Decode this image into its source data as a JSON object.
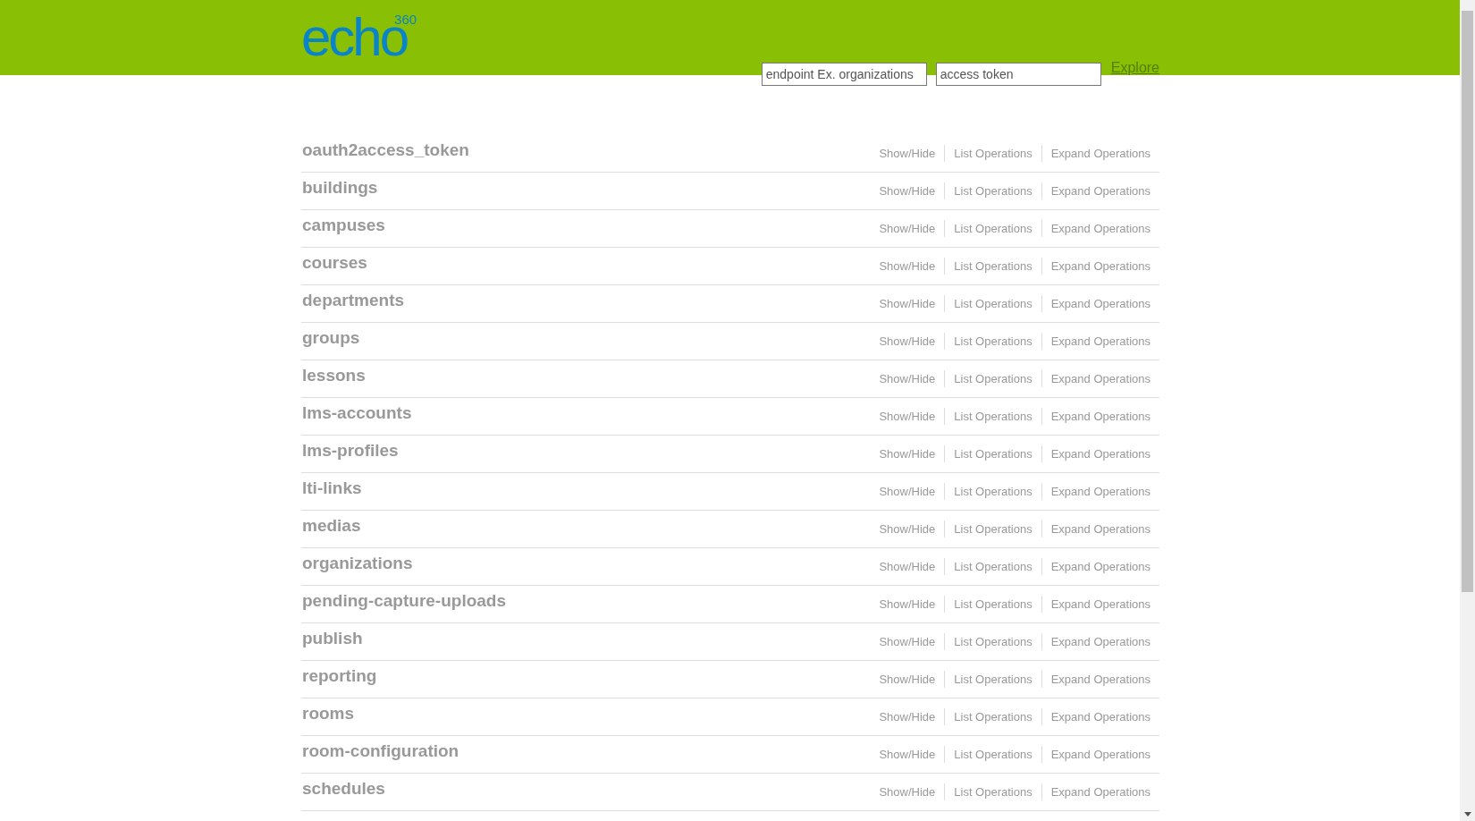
{
  "header": {
    "logo": {
      "text": "echo",
      "superscript": "360"
    },
    "endpoint_field": {
      "placeholder": "endpoint Ex. organizations"
    },
    "token_field": {
      "placeholder": "access token"
    },
    "explore_link": "Explore"
  },
  "resources": [
    {
      "name": "oauth2access_token",
      "links": [
        "Show/Hide",
        "List Operations",
        "Expand Operations"
      ]
    },
    {
      "name": "buildings",
      "links": [
        "Show/Hide",
        "List Operations",
        "Expand Operations"
      ]
    },
    {
      "name": "campuses",
      "links": [
        "Show/Hide",
        "List Operations",
        "Expand Operations"
      ]
    },
    {
      "name": "courses",
      "links": [
        "Show/Hide",
        "List Operations",
        "Expand Operations"
      ]
    },
    {
      "name": "departments",
      "links": [
        "Show/Hide",
        "List Operations",
        "Expand Operations"
      ]
    },
    {
      "name": "groups",
      "links": [
        "Show/Hide",
        "List Operations",
        "Expand Operations"
      ]
    },
    {
      "name": "lessons",
      "links": [
        "Show/Hide",
        "List Operations",
        "Expand Operations"
      ]
    },
    {
      "name": "lms-accounts",
      "links": [
        "Show/Hide",
        "List Operations",
        "Expand Operations"
      ]
    },
    {
      "name": "lms-profiles",
      "links": [
        "Show/Hide",
        "List Operations",
        "Expand Operations"
      ]
    },
    {
      "name": "lti-links",
      "links": [
        "Show/Hide",
        "List Operations",
        "Expand Operations"
      ]
    },
    {
      "name": "medias",
      "links": [
        "Show/Hide",
        "List Operations",
        "Expand Operations"
      ]
    },
    {
      "name": "organizations",
      "links": [
        "Show/Hide",
        "List Operations",
        "Expand Operations"
      ]
    },
    {
      "name": "pending-capture-uploads",
      "links": [
        "Show/Hide",
        "List Operations",
        "Expand Operations"
      ]
    },
    {
      "name": "publish",
      "links": [
        "Show/Hide",
        "List Operations",
        "Expand Operations"
      ]
    },
    {
      "name": "reporting",
      "links": [
        "Show/Hide",
        "List Operations",
        "Expand Operations"
      ]
    },
    {
      "name": "rooms",
      "links": [
        "Show/Hide",
        "List Operations",
        "Expand Operations"
      ]
    },
    {
      "name": "room-configuration",
      "links": [
        "Show/Hide",
        "List Operations",
        "Expand Operations"
      ]
    },
    {
      "name": "schedules",
      "links": [
        "Show/Hide",
        "List Operations",
        "Expand Operations"
      ]
    }
  ]
}
